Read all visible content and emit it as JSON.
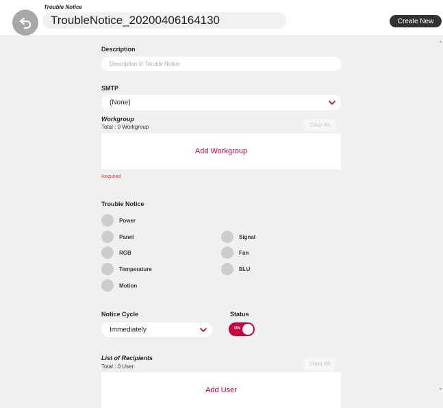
{
  "header": {
    "label": "Trouble Notice",
    "title_value": "TroubleNotice_20200406164130",
    "create_label": "Create New"
  },
  "form": {
    "description": {
      "label": "Description",
      "placeholder": "Description of Trouble Notice"
    },
    "smtp": {
      "label": "SMTP",
      "value": "(None)"
    },
    "workgroup": {
      "label": "Workgroup",
      "total": "Total : 0 Workgroup",
      "clear_label": "Clear All",
      "add_label": "Add Workgroup",
      "required": "Required"
    },
    "trouble_notice": {
      "label": "Trouble Notice",
      "items": [
        "Power",
        "Panel",
        "Signal",
        "RGB",
        "Fan",
        "Temperature",
        "BLU",
        "Motion"
      ]
    },
    "notice_cycle": {
      "label": "Notice Cycle",
      "value": "Immediately"
    },
    "status": {
      "label": "Status",
      "toggle_text": "ON"
    },
    "recipients": {
      "label": "List of Recipients",
      "total": "Total : 0 User",
      "clear_label": "Clear All",
      "add_label": "Add User"
    }
  },
  "colors": {
    "accent": "#c8003f",
    "required": "#e03030",
    "background": "#f0f0f0"
  },
  "icons": [
    "back-arrow-icon",
    "chevron-down-icon"
  ]
}
